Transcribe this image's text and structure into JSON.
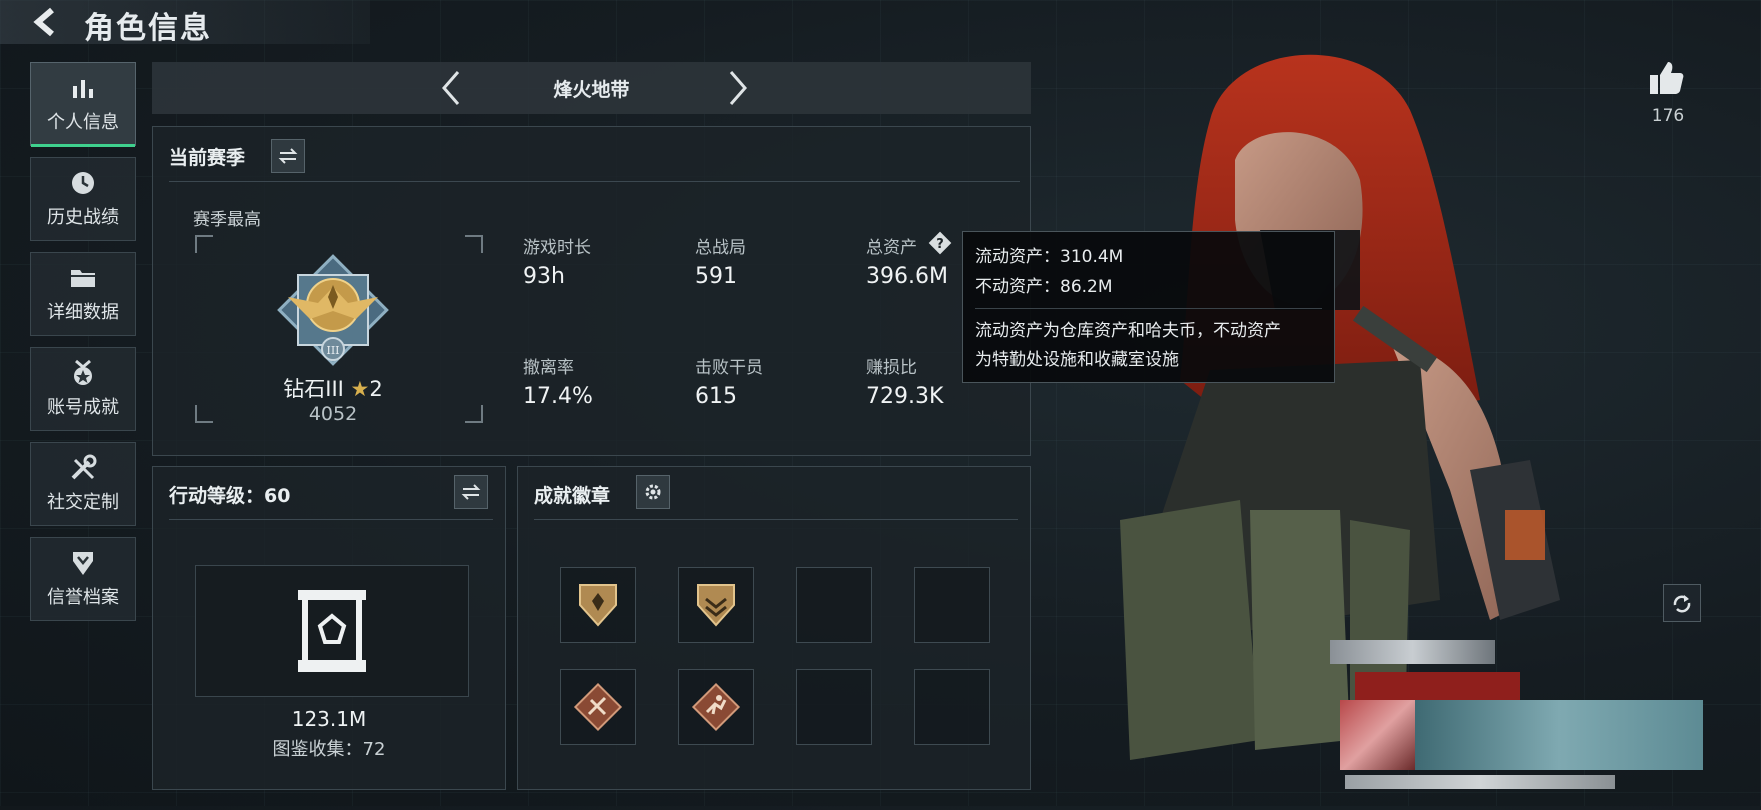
{
  "header": {
    "title": "角色信息"
  },
  "sidebar": {
    "items": [
      {
        "label": "个人信息",
        "icon": "bar-chart-icon",
        "active": true
      },
      {
        "label": "历史战绩",
        "icon": "clock-icon",
        "active": false
      },
      {
        "label": "详细数据",
        "icon": "folder-icon",
        "active": false
      },
      {
        "label": "账号成就",
        "icon": "medal-icon",
        "active": false
      },
      {
        "label": "社交定制",
        "icon": "tools-icon",
        "active": false
      },
      {
        "label": "信誉档案",
        "icon": "shield-icon",
        "active": false
      }
    ]
  },
  "mode": {
    "name": "烽火地带"
  },
  "season": {
    "title": "当前赛季",
    "best_label": "赛季最高",
    "rank_name": "钻石III",
    "rank_stars": "2",
    "rank_score": "4052",
    "stats": [
      {
        "label": "游戏时长",
        "value": "93h"
      },
      {
        "label": "总战局",
        "value": "591"
      },
      {
        "label": "总资产",
        "value": "396.6M"
      },
      {
        "label": "撤离率",
        "value": "17.4%"
      },
      {
        "label": "击败干员",
        "value": "615"
      },
      {
        "label": "赚损比",
        "value": "729.3K"
      }
    ]
  },
  "tooltip": {
    "liquid": "流动资产：310.4M",
    "fixed": "不动资产：86.2M",
    "note_line1": "流动资产为仓库资产和哈夫币，不动资产",
    "note_line2": "为特勤处设施和收藏室设施"
  },
  "level": {
    "title": "行动等级：60",
    "collection_value": "123.1M",
    "collection_label": "图鉴收集：72"
  },
  "badges": {
    "title": "成就徽章",
    "slots": [
      "shield-badge-icon",
      "chevron-shield-badge-icon",
      "",
      "",
      "diamond-tools-badge-icon",
      "diamond-runner-badge-icon",
      "",
      ""
    ]
  },
  "likes": {
    "count": "176",
    "icon": "thumbs-up-icon"
  },
  "colors": {
    "accent": "#3fd18e",
    "tooltip_bg": "#08090b",
    "panel_border": "#3b474e"
  }
}
